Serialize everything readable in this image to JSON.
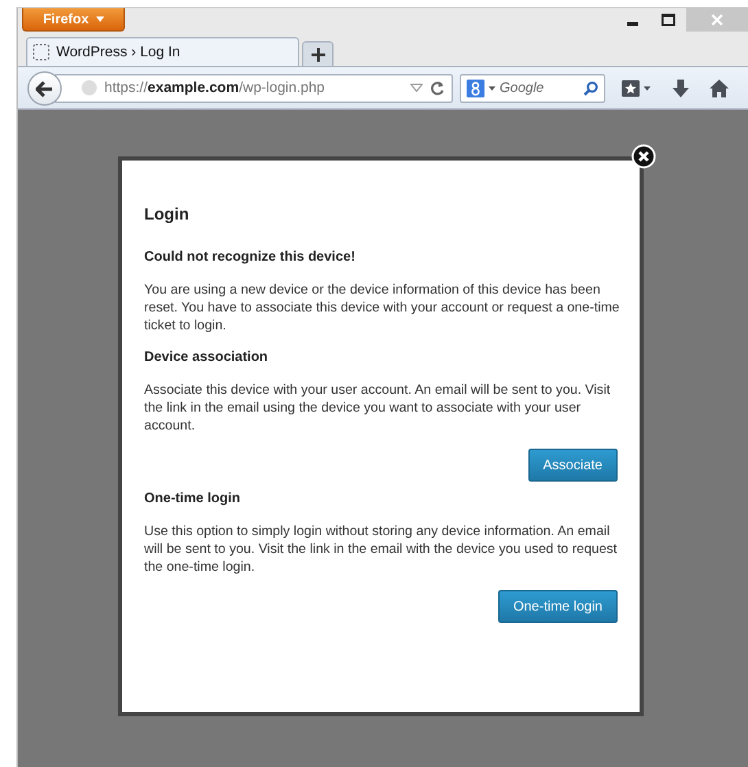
{
  "browser": {
    "menu_button": "Firefox",
    "tabs": [
      {
        "title": "WordPress › Log In",
        "selected": true
      }
    ],
    "address": "https://**example.com**/wp-login.php",
    "search": {
      "placeholder": "Google"
    }
  },
  "dialog": {
    "title": "Login",
    "sections": [
      {
        "kind": "notice",
        "heading": "Could not recognize this device!",
        "text": "You are using a new device or the device information of this device has been reset. You have to associate this device with your account or request a one-time ticket to login."
      },
      {
        "kind": "action",
        "heading": "Device association",
        "text": "Associate this device with your user account. An email will be sent to you. Visit the link in the email using the device you want to associate with your user account.",
        "button": "Associate"
      },
      {
        "kind": "action",
        "heading": "One-time login",
        "text": "Use this option to simply login without storing any device information. An email will be sent to you. Visit the link in the email with the device you used to request the one-time login.",
        "button": "One-time login"
      }
    ]
  }
}
